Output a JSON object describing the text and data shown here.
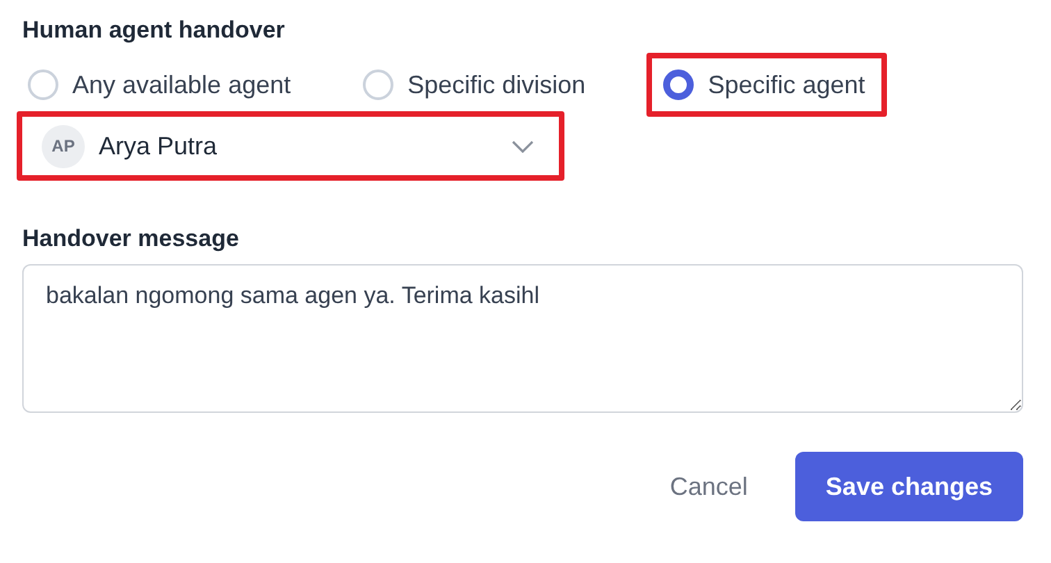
{
  "handover": {
    "title": "Human agent handover",
    "options": [
      {
        "label": "Any available agent",
        "selected": false,
        "highlighted": false
      },
      {
        "label": "Specific division",
        "selected": false,
        "highlighted": false
      },
      {
        "label": "Specific agent",
        "selected": true,
        "highlighted": true
      }
    ],
    "agent_select": {
      "initials": "AP",
      "value": "Arya Putra",
      "highlighted": true
    }
  },
  "message": {
    "label": "Handover message",
    "value": "bakalan ngomong sama agen ya. Terima kasihl"
  },
  "buttons": [
    {
      "label": "Cancel",
      "kind": "secondary"
    },
    {
      "label": "Save changes",
      "kind": "primary"
    }
  ]
}
